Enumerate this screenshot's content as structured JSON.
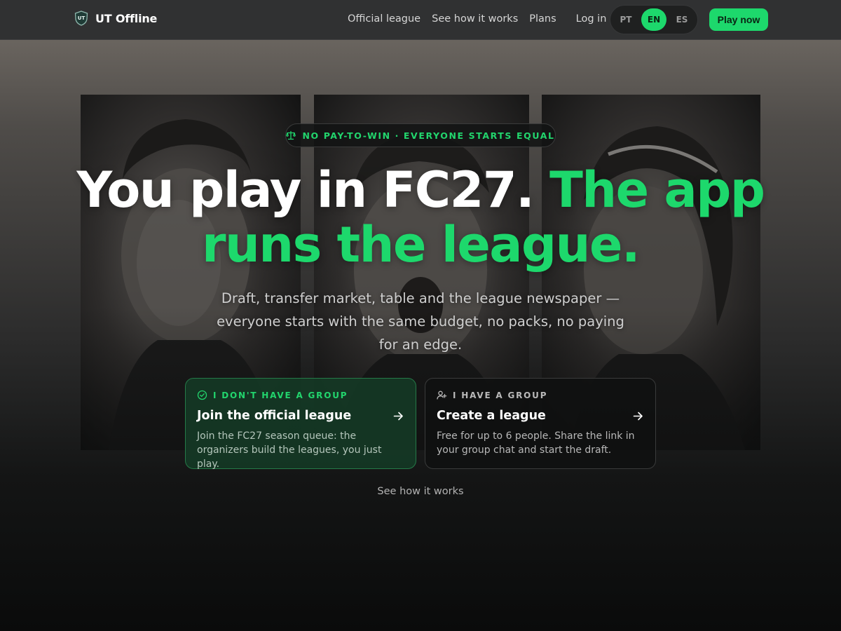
{
  "header": {
    "brand_name": "UT Offline",
    "brand_logo_text": "UT",
    "nav": {
      "official_league": "Official league",
      "how_it_works": "See how it works",
      "plans": "Plans",
      "login": "Log in"
    },
    "languages": [
      "PT",
      "EN",
      "ES"
    ],
    "active_language": "EN",
    "cta_label": "Play now"
  },
  "hero": {
    "badge": "NO PAY-TO-WIN · EVERYONE STARTS EQUAL",
    "headline_white": "You play in FC27.",
    "headline_green_1": "The app",
    "headline_green_2": "runs the league.",
    "subtitle": "Draft, transfer market, table and the league newspaper — everyone starts with the same budget, no packs, no paying for an edge.",
    "cards": [
      {
        "eyebrow": "I DON'T HAVE A GROUP",
        "title": "Join the official league",
        "description": "Join the FC27 season queue: the organizers build the leagues, you just play.",
        "icon": "check-circle-icon"
      },
      {
        "eyebrow": "I HAVE A GROUP",
        "title": "Create a league",
        "description": "Free for up to 6 people. Share the link in your group chat and start the draft.",
        "icon": "user-plus-icon"
      }
    ],
    "secondary_link": "See how it works"
  },
  "colors": {
    "accent": "#1dd86c",
    "header_bg": "#303132",
    "card_join_bg": "#153a26",
    "card_create_bg": "#101111"
  }
}
